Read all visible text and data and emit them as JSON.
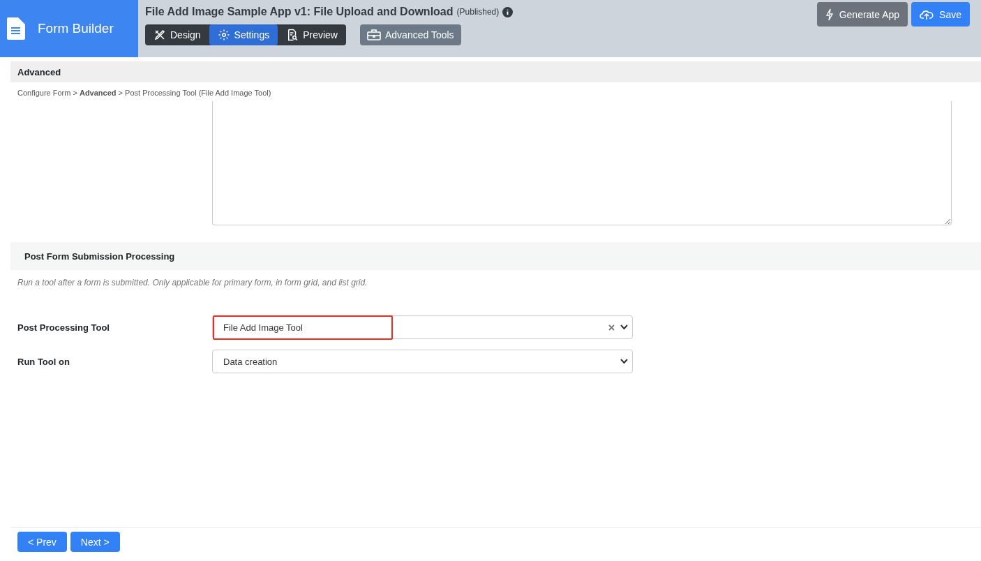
{
  "app": {
    "name": "Form Builder"
  },
  "header": {
    "title": "File Add Image Sample App v1: File Upload and Download",
    "status": "(Published)",
    "tabs": [
      {
        "label": "Design",
        "kind": "design",
        "selected": false
      },
      {
        "label": "Settings",
        "kind": "settings",
        "selected": true
      },
      {
        "label": "Preview",
        "kind": "preview",
        "selected": false
      }
    ],
    "tools_button": "Advanced Tools",
    "actions": [
      {
        "label": "Generate App",
        "kind": "secondary"
      },
      {
        "label": "Save",
        "kind": "primary"
      }
    ]
  },
  "page": {
    "title": "Advanced",
    "breadcrumb": "Configure Form > **Advanced** > Post Processing Tool (File Add Image Tool)"
  },
  "section": {
    "title": "Post Form Submission Processing",
    "description": "Run a tool after a form is submitted. Only applicable for primary form, in form grid, and list grid.",
    "fields": [
      {
        "label": "Post Processing Tool",
        "value": "File Add Image Tool",
        "clearable": true,
        "highlighted": true
      },
      {
        "label": "Run Tool on",
        "value": "Data creation",
        "clearable": false,
        "highlighted": false
      }
    ]
  },
  "footer": {
    "buttons": [
      "< Prev",
      "Next >"
    ]
  }
}
